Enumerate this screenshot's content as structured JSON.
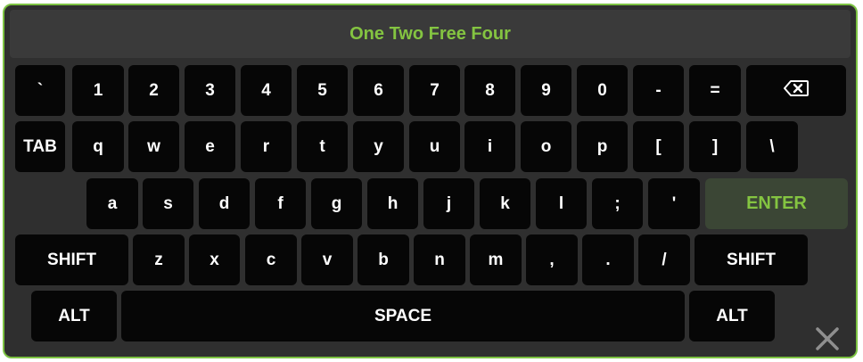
{
  "display": {
    "text": "One Two Free Four"
  },
  "rows": [
    [
      {
        "name": "key-backtick",
        "label": "`"
      },
      {
        "name": "key-1",
        "label": "1"
      },
      {
        "name": "key-2",
        "label": "2"
      },
      {
        "name": "key-3",
        "label": "3"
      },
      {
        "name": "key-4",
        "label": "4"
      },
      {
        "name": "key-5",
        "label": "5"
      },
      {
        "name": "key-6",
        "label": "6"
      },
      {
        "name": "key-7",
        "label": "7"
      },
      {
        "name": "key-8",
        "label": "8"
      },
      {
        "name": "key-9",
        "label": "9"
      },
      {
        "name": "key-0",
        "label": "0"
      },
      {
        "name": "key-minus",
        "label": "-"
      },
      {
        "name": "key-equals",
        "label": "="
      },
      {
        "name": "backspace-key",
        "label": "",
        "icon": "backspace-icon"
      }
    ],
    [
      {
        "name": "tab-key",
        "label": "TAB"
      },
      {
        "name": "key-q",
        "label": "q"
      },
      {
        "name": "key-w",
        "label": "w"
      },
      {
        "name": "key-e",
        "label": "e"
      },
      {
        "name": "key-r",
        "label": "r"
      },
      {
        "name": "key-t",
        "label": "t"
      },
      {
        "name": "key-y",
        "label": "y"
      },
      {
        "name": "key-u",
        "label": "u"
      },
      {
        "name": "key-i",
        "label": "i"
      },
      {
        "name": "key-o",
        "label": "o"
      },
      {
        "name": "key-p",
        "label": "p"
      },
      {
        "name": "key-left-bracket",
        "label": "["
      },
      {
        "name": "key-right-bracket",
        "label": "]"
      },
      {
        "name": "key-backslash",
        "label": "\\"
      }
    ],
    [
      {
        "name": "key-a",
        "label": "a"
      },
      {
        "name": "key-s",
        "label": "s"
      },
      {
        "name": "key-d",
        "label": "d"
      },
      {
        "name": "key-f",
        "label": "f"
      },
      {
        "name": "key-g",
        "label": "g"
      },
      {
        "name": "key-h",
        "label": "h"
      },
      {
        "name": "key-j",
        "label": "j"
      },
      {
        "name": "key-k",
        "label": "k"
      },
      {
        "name": "key-l",
        "label": "l"
      },
      {
        "name": "key-semicolon",
        "label": ";"
      },
      {
        "name": "key-quote",
        "label": "'"
      },
      {
        "name": "enter-key",
        "label": "ENTER"
      }
    ],
    [
      {
        "name": "left-shift-key",
        "label": "SHIFT"
      },
      {
        "name": "key-z",
        "label": "z"
      },
      {
        "name": "key-x",
        "label": "x"
      },
      {
        "name": "key-c",
        "label": "c"
      },
      {
        "name": "key-v",
        "label": "v"
      },
      {
        "name": "key-b",
        "label": "b"
      },
      {
        "name": "key-n",
        "label": "n"
      },
      {
        "name": "key-m",
        "label": "m"
      },
      {
        "name": "key-comma",
        "label": ","
      },
      {
        "name": "key-period",
        "label": "."
      },
      {
        "name": "key-slash",
        "label": "/"
      },
      {
        "name": "right-shift-key",
        "label": "SHIFT"
      }
    ],
    [
      {
        "name": "left-alt-key",
        "label": "ALT"
      },
      {
        "name": "space-key",
        "label": "SPACE"
      },
      {
        "name": "right-alt-key",
        "label": "ALT"
      }
    ]
  ],
  "close": {
    "icon": "close-icon"
  },
  "colors": {
    "accent": "#84c441",
    "border": "#7cc242",
    "panel": "#2f2f2f",
    "display": "#3a3a3a",
    "key": "#060606",
    "enter_key": "#3b4635"
  }
}
